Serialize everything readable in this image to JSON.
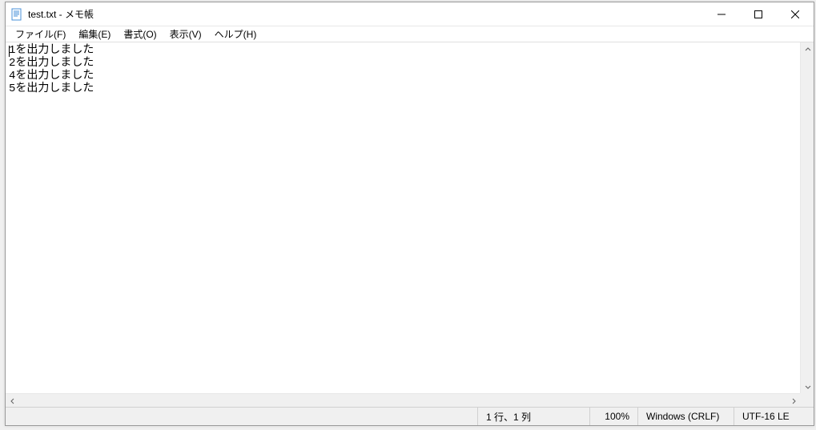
{
  "titlebar": {
    "title": "test.txt - メモ帳"
  },
  "menubar": {
    "items": [
      {
        "label": "ファイル(F)"
      },
      {
        "label": "編集(E)"
      },
      {
        "label": "書式(O)"
      },
      {
        "label": "表示(V)"
      },
      {
        "label": "ヘルプ(H)"
      }
    ]
  },
  "editor": {
    "lines": [
      "1を出力しました",
      "2を出力しました",
      "4を出力しました",
      "5を出力しました"
    ]
  },
  "statusbar": {
    "position": "1 行、1 列",
    "zoom": "100%",
    "eol": "Windows (CRLF)",
    "encoding": "UTF-16 LE"
  }
}
